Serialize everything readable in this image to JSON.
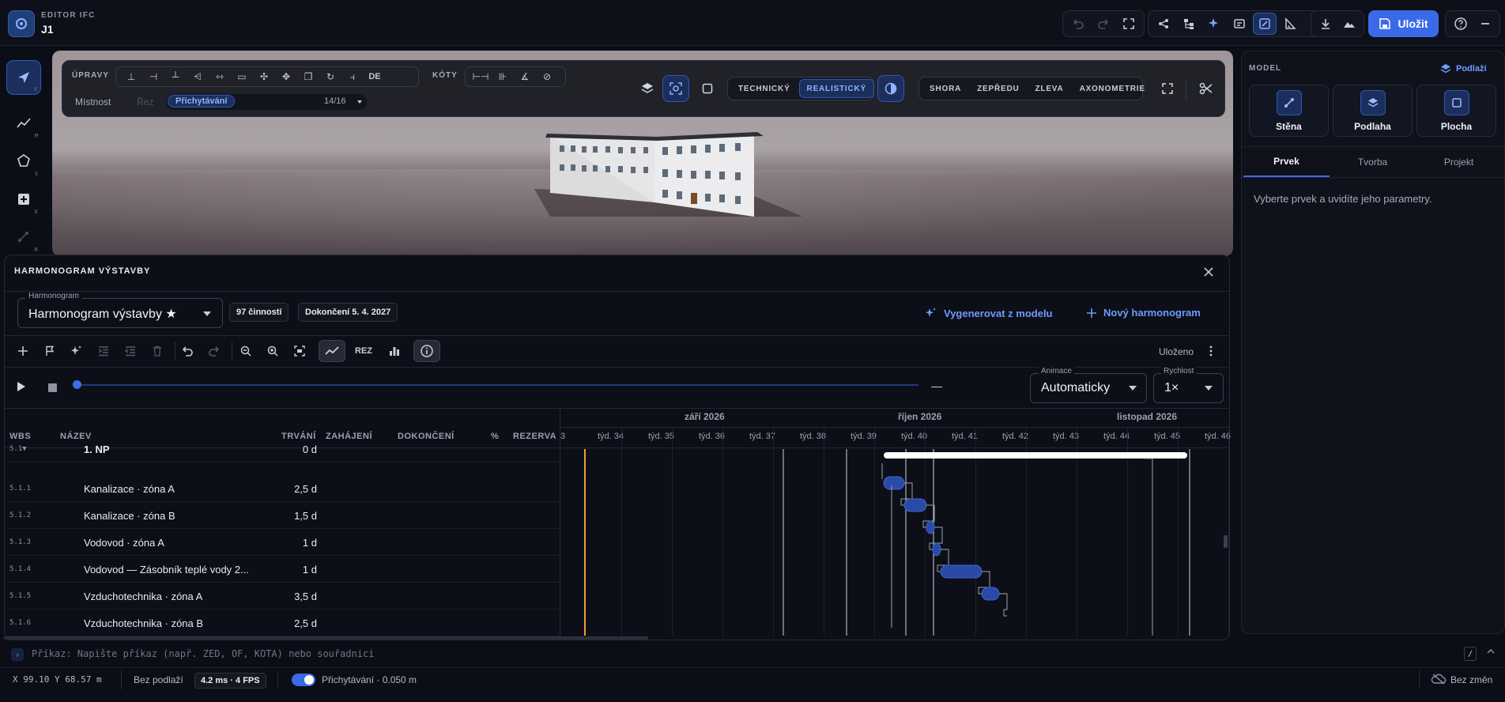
{
  "app": {
    "kicker": "EDITOR IFC",
    "title": "J1",
    "save_label": "Uložit"
  },
  "rail": {
    "keys": [
      "V",
      "M",
      "S",
      "E",
      "R"
    ]
  },
  "viewport_toolbar": {
    "edits_label": "ÚPRAVY",
    "edits_extra": "DE",
    "dims_label": "KÓTY",
    "room_label": "Místnost",
    "section_label": "Řez",
    "snap_label": "Přichytávání",
    "snap_count": "14/16",
    "render_modes": [
      "TECHNICKÝ",
      "REALISTICKÝ"
    ],
    "views": [
      "SHORA",
      "ZEPŘEDU",
      "ZLEVA",
      "AXONOMETRIE"
    ]
  },
  "right_panel": {
    "title": "MODEL",
    "floor_link": "Podlaží",
    "cards": [
      "Stěna",
      "Podlaha",
      "Plocha"
    ],
    "tabs": [
      "Prvek",
      "Tvorba",
      "Projekt"
    ],
    "hint": "Vyberte prvek a uvidíte jeho parametry."
  },
  "schedule": {
    "title": "HARMONOGRAM VÝSTAVBY",
    "select_legend": "Harmonogram",
    "select_value": "Harmonogram výstavby ★",
    "activities_chip": "97 činností",
    "completion_chip": "Dokončení 5. 4. 2027",
    "generate_label": "Vygenerovat z modelu",
    "new_label": "Nový harmonogram",
    "section_btn": "REZ",
    "saved_label": "Uloženo",
    "timeline_dash": "—",
    "animation_legend": "Animace",
    "animation_value": "Automaticky",
    "speed_legend": "Rychlost",
    "speed_value": "1×",
    "columns": [
      "WBS",
      "NÁZEV",
      "TRVÁNÍ",
      "ZAHÁJENÍ",
      "DOKONČENÍ",
      "%",
      "REZERVA"
    ],
    "rows": [
      {
        "wbs": "5.1▼",
        "name": "1. NP",
        "duration": "0 d"
      },
      {
        "wbs": "5.1.1",
        "name": "Kanalizace · zóna A",
        "duration": "2,5 d"
      },
      {
        "wbs": "5.1.2",
        "name": "Kanalizace · zóna B",
        "duration": "1,5 d"
      },
      {
        "wbs": "5.1.3",
        "name": "Vodovod · zóna A",
        "duration": "1 d"
      },
      {
        "wbs": "5.1.4",
        "name": "Vodovod — Zásobník teplé vody 2...",
        "duration": "1 d"
      },
      {
        "wbs": "5.1.5",
        "name": "Vzduchotechnika · zóna A",
        "duration": "3,5 d"
      },
      {
        "wbs": "5.1.6",
        "name": "Vzduchotechnika · zóna B",
        "duration": "2,5 d"
      }
    ],
    "months": [
      "září 2026",
      "říjen 2026",
      "listopad 2026"
    ],
    "weeks": [
      "3",
      "týd. 34",
      "týd. 35",
      "týd. 36",
      "týd. 37",
      "týd. 38",
      "týd. 39",
      "týd. 40",
      "týd. 41",
      "týd. 42",
      "týd. 43",
      "týd. 44",
      "týd. 45",
      "týd. 46"
    ]
  },
  "command": {
    "placeholder": "Příkaz: Napište příkaz (např. ZED, OF, KOTA) nebo souřadnici",
    "shortcut": "/"
  },
  "status": {
    "coords": "X 99.10 Y 68.57 m",
    "floor": "Bez podlaží",
    "fps": "4.2 ms · 4 FPS",
    "snap": "Přichytávání · 0.050 m",
    "changes": "Bez změn"
  },
  "colors": {
    "accent": "#3a6ae8",
    "accent_text": "#6f9bff",
    "today_line": "#f0a030",
    "summary_bar": "#ffffff",
    "task_bar": "#2a4aa8"
  }
}
